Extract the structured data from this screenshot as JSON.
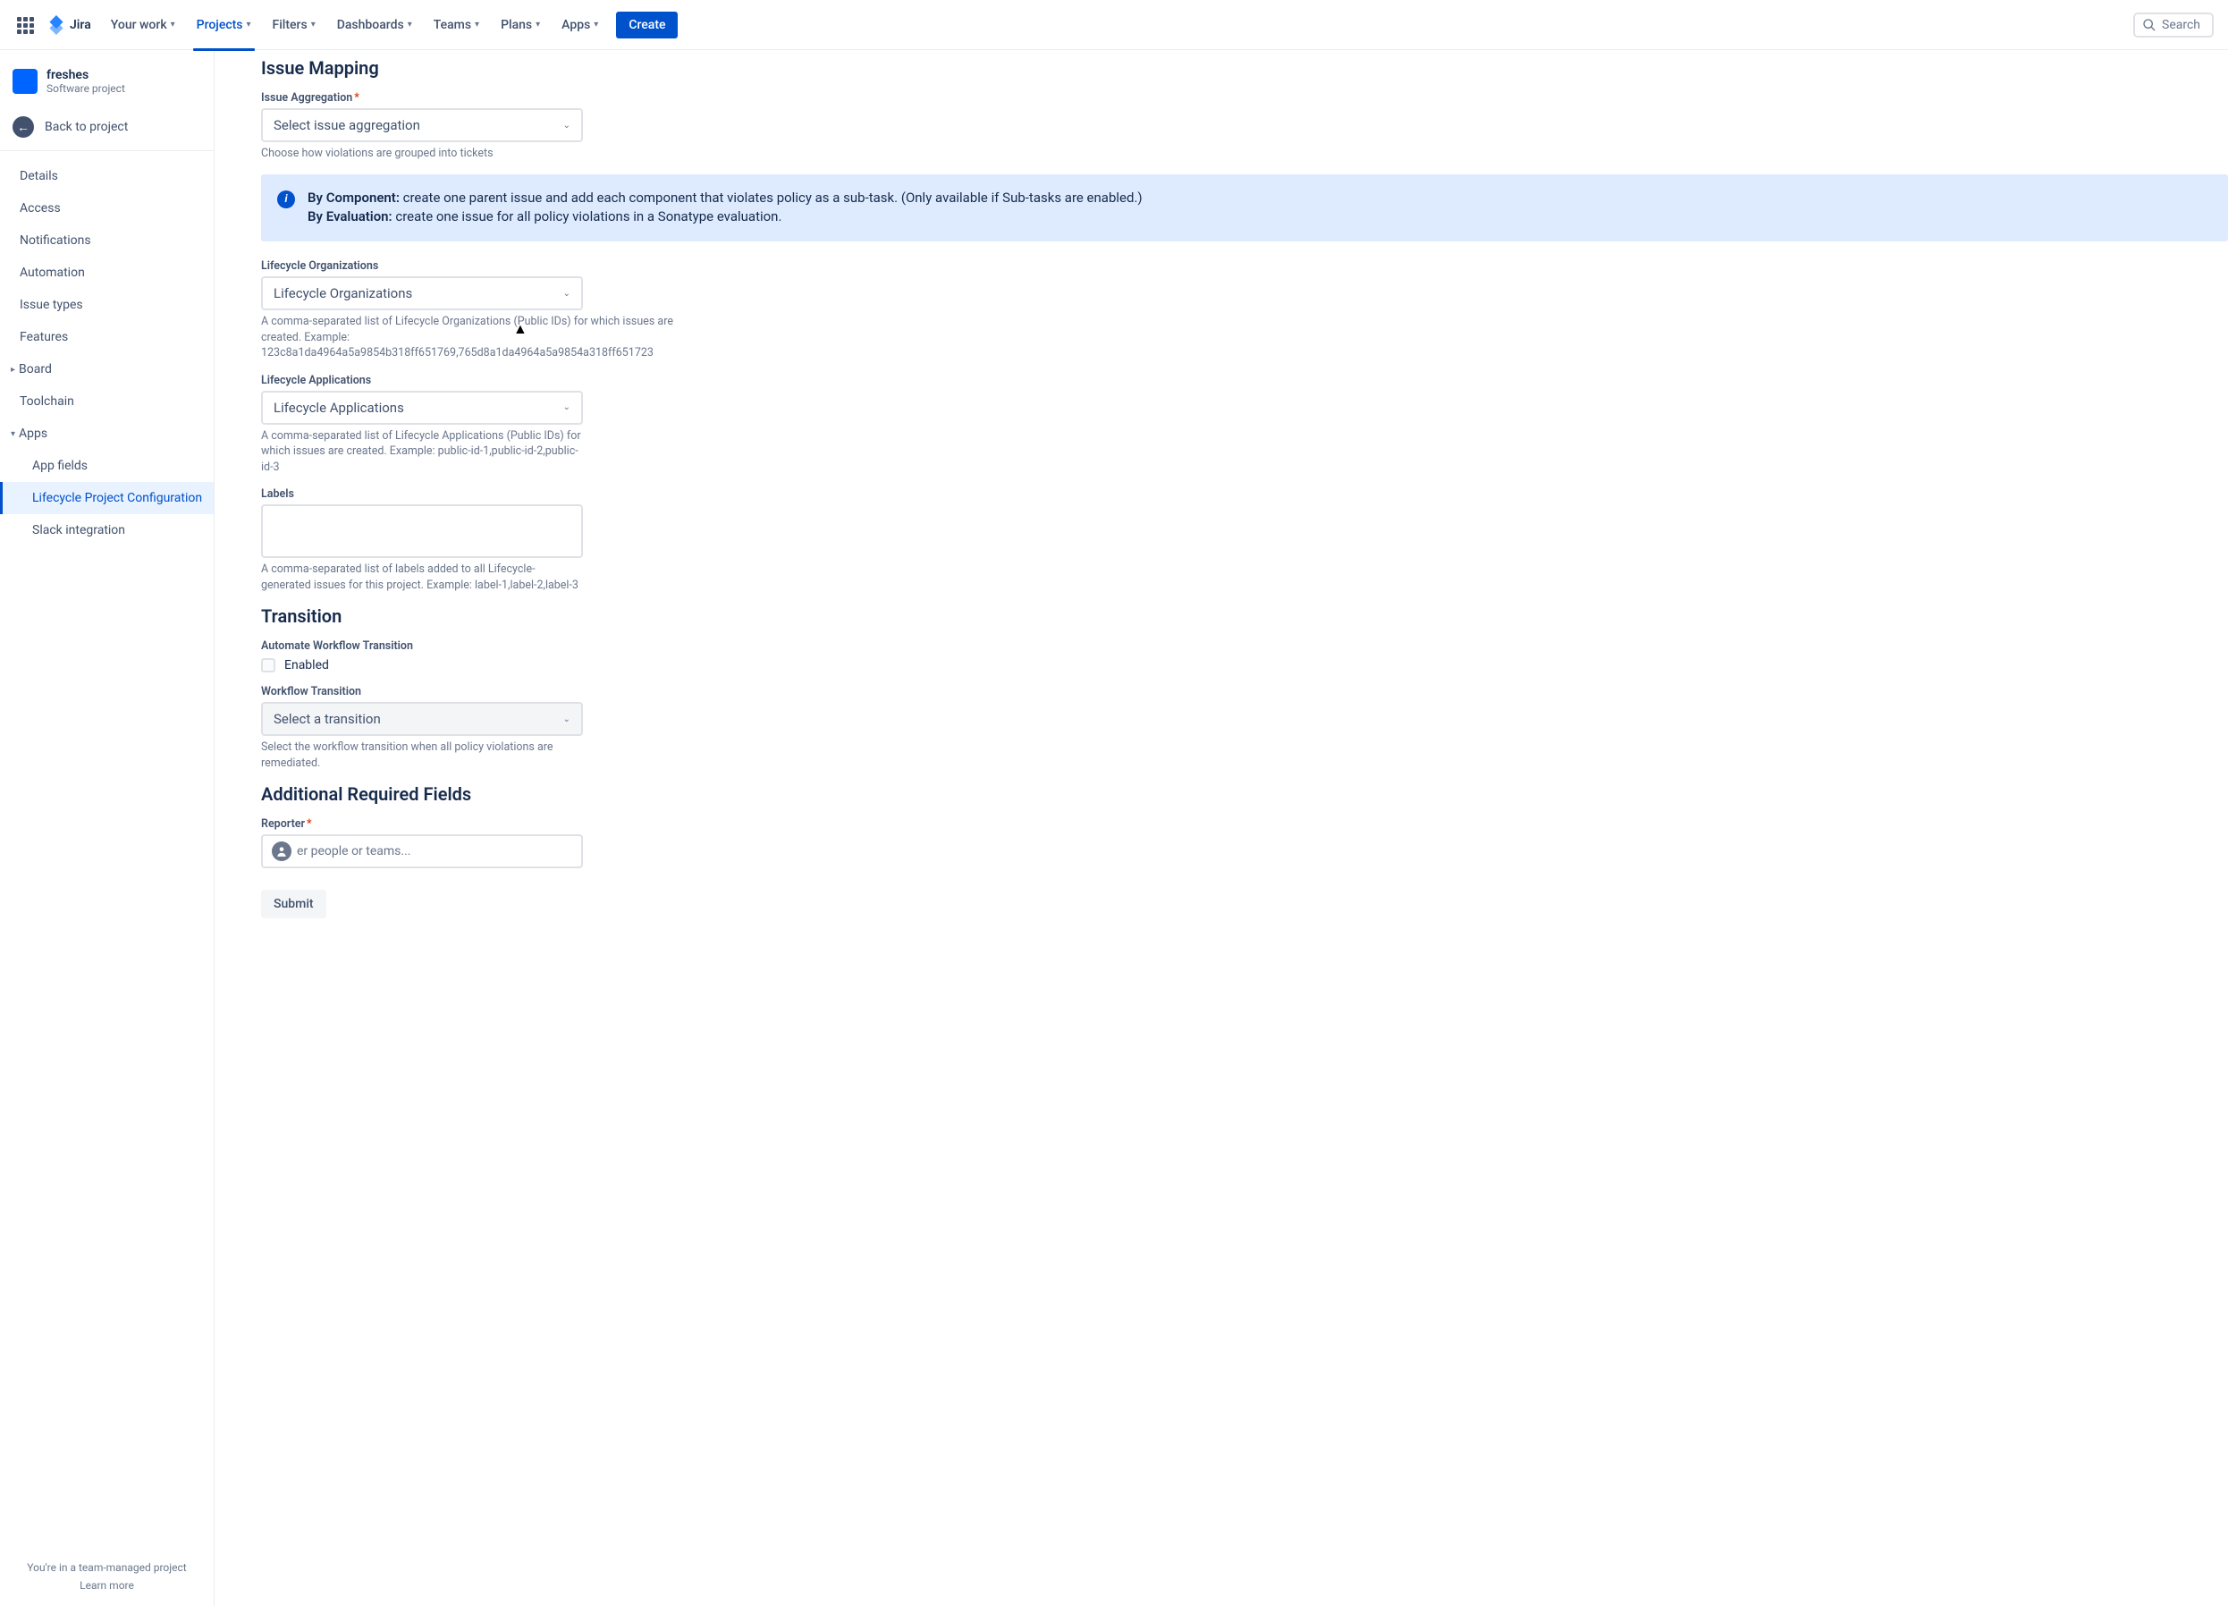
{
  "header": {
    "logo_text": "Jira",
    "nav": {
      "your_work": "Your work",
      "projects": "Projects",
      "filters": "Filters",
      "dashboards": "Dashboards",
      "teams": "Teams",
      "plans": "Plans",
      "apps": "Apps"
    },
    "create": "Create",
    "search_placeholder": "Search"
  },
  "sidebar": {
    "project_name": "freshes",
    "project_type": "Software project",
    "back": "Back to project",
    "items": {
      "details": "Details",
      "access": "Access",
      "notifications": "Notifications",
      "automation": "Automation",
      "issue_types": "Issue types",
      "features": "Features",
      "board": "Board",
      "toolchain": "Toolchain",
      "apps": "Apps"
    },
    "subitems": {
      "app_fields": "App fields",
      "lifecycle": "Lifecycle Project Configuration",
      "slack": "Slack integration"
    },
    "footer_text": "You're in a team-managed project",
    "footer_link": "Learn more"
  },
  "form": {
    "issue_mapping_title": "Issue Mapping",
    "issue_aggregation_label": "Issue Aggregation",
    "issue_aggregation_placeholder": "Select issue aggregation",
    "issue_aggregation_hint": "Choose how violations are grouped into tickets",
    "info_component_label": "By Component:",
    "info_component_text": " create one parent issue and add each component that violates policy as a sub-task. (Only available if Sub-tasks are enabled.)",
    "info_evaluation_label": "By Evaluation:",
    "info_evaluation_text": " create one issue for all policy violations in a Sonatype evaluation.",
    "orgs_label": "Lifecycle Organizations",
    "orgs_placeholder": "Lifecycle Organizations",
    "orgs_hint": "A comma-separated list of Lifecycle Organizations (Public IDs) for which issues are created. Example: 123c8a1da4964a5a9854b318ff651769,765d8a1da4964a5a9854a318ff651723",
    "apps_label": "Lifecycle Applications",
    "apps_placeholder": "Lifecycle Applications",
    "apps_hint": "A comma-separated list of Lifecycle Applications (Public IDs) for which issues are created. Example: public-id-1,public-id-2,public-id-3",
    "labels_label": "Labels",
    "labels_hint": "A comma-separated list of labels added to all Lifecycle-generated issues for this project. Example: label-1,label-2,label-3",
    "transition_title": "Transition",
    "automate_label": "Automate Workflow Transition",
    "enabled_checkbox": "Enabled",
    "workflow_label": "Workflow Transition",
    "workflow_placeholder": "Select a transition",
    "workflow_hint": "Select the workflow transition when all policy violations are remediated.",
    "additional_title": "Additional Required Fields",
    "reporter_label": "Reporter",
    "reporter_placeholder": "er people or teams...",
    "submit": "Submit"
  }
}
